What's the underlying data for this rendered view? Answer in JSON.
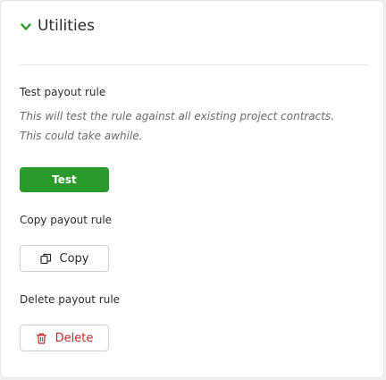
{
  "utilities": {
    "title": "Utilities",
    "test": {
      "label": "Test payout rule",
      "note_line1": "This will test the rule against all existing project contracts.",
      "note_line2": "This could take awhile.",
      "button_label": "Test"
    },
    "copy": {
      "label": "Copy payout rule",
      "button_label": "Copy",
      "icon": "copy-icon"
    },
    "delete": {
      "label": "Delete payout rule",
      "button_label": "Delete",
      "icon": "trash-icon"
    }
  },
  "colors": {
    "primary": "#2a9a2c",
    "danger": "#c62828",
    "chevron": "#2a9a2c"
  }
}
